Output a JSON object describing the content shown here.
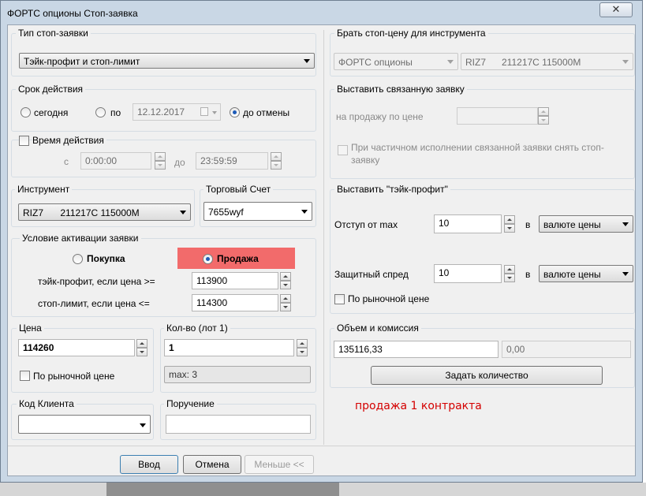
{
  "window": {
    "title": "ФОРТС опционы Стоп-заявка",
    "close_glyph": "✕"
  },
  "stop_type": {
    "label": "Тип стоп-заявки",
    "value": "Тэйк-профит и стоп-лимит"
  },
  "validity": {
    "label": "Срок действия",
    "today": "сегодня",
    "until": "по",
    "date": "12.12.2017",
    "gtc": "до отмены",
    "selected": "gtc"
  },
  "time": {
    "label": "Время действия",
    "from_label": "с",
    "from": "0:00:00",
    "to_label": "до",
    "to": "23:59:59"
  },
  "instrument": {
    "label": "Инструмент",
    "code": "RIZ7",
    "name": "211217C 115000M"
  },
  "account": {
    "label": "Торговый Счет",
    "value": "7655wyf"
  },
  "activation": {
    "label": "Условие активации заявки",
    "buy": "Покупка",
    "sell": "Продажа",
    "selected": "sell",
    "tp_label": "тэйк-профит, если цена >=",
    "tp_value": "113900",
    "sl_label": "стоп-лимит, если цена <=",
    "sl_value": "114300"
  },
  "price": {
    "label": "Цена",
    "value": "114260",
    "market_label": "По рыночной цене"
  },
  "qty": {
    "label": "Кол-во (лот 1)",
    "value": "1",
    "max": "max: 3"
  },
  "client": {
    "label": "Код Клиента",
    "value": ""
  },
  "order_note": {
    "label": "Поручение",
    "value": ""
  },
  "take_stop_price": {
    "label": "Брать стоп-цену для инструмента",
    "class": "ФОРТС опционы",
    "instrument": "RIZ7      211217C 115000M"
  },
  "linked": {
    "label": "Выставить связанную заявку",
    "price_label": "на продажу по цене",
    "price": "",
    "partial_label": "При частичном исполнении связанной заявки снять стоп-заявку"
  },
  "take_profit": {
    "label": "Выставить \"тэйк-профит\"",
    "offset_label": "Отступ от max",
    "offset": "10",
    "in": "в",
    "units1": "валюте цены",
    "spread_label": "Защитный спред",
    "spread": "10",
    "units2": "валюте цены",
    "market_label": "По рыночной цене"
  },
  "volume": {
    "label": "Объем и комиссия",
    "amount": "135116,33",
    "commission": "0,00",
    "set_qty_button": "Задать количество"
  },
  "note": {
    "text": "продажа 1 контракта",
    "color": "#d40000"
  },
  "buttons": {
    "ok": "Ввод",
    "cancel": "Отмена",
    "less": "Меньше <<"
  },
  "colors": {
    "sell_highlight": "#f26b6b",
    "accent": "#1d5bb8"
  },
  "icons": {
    "calendar": "calendar-icon",
    "close": "close-icon"
  }
}
